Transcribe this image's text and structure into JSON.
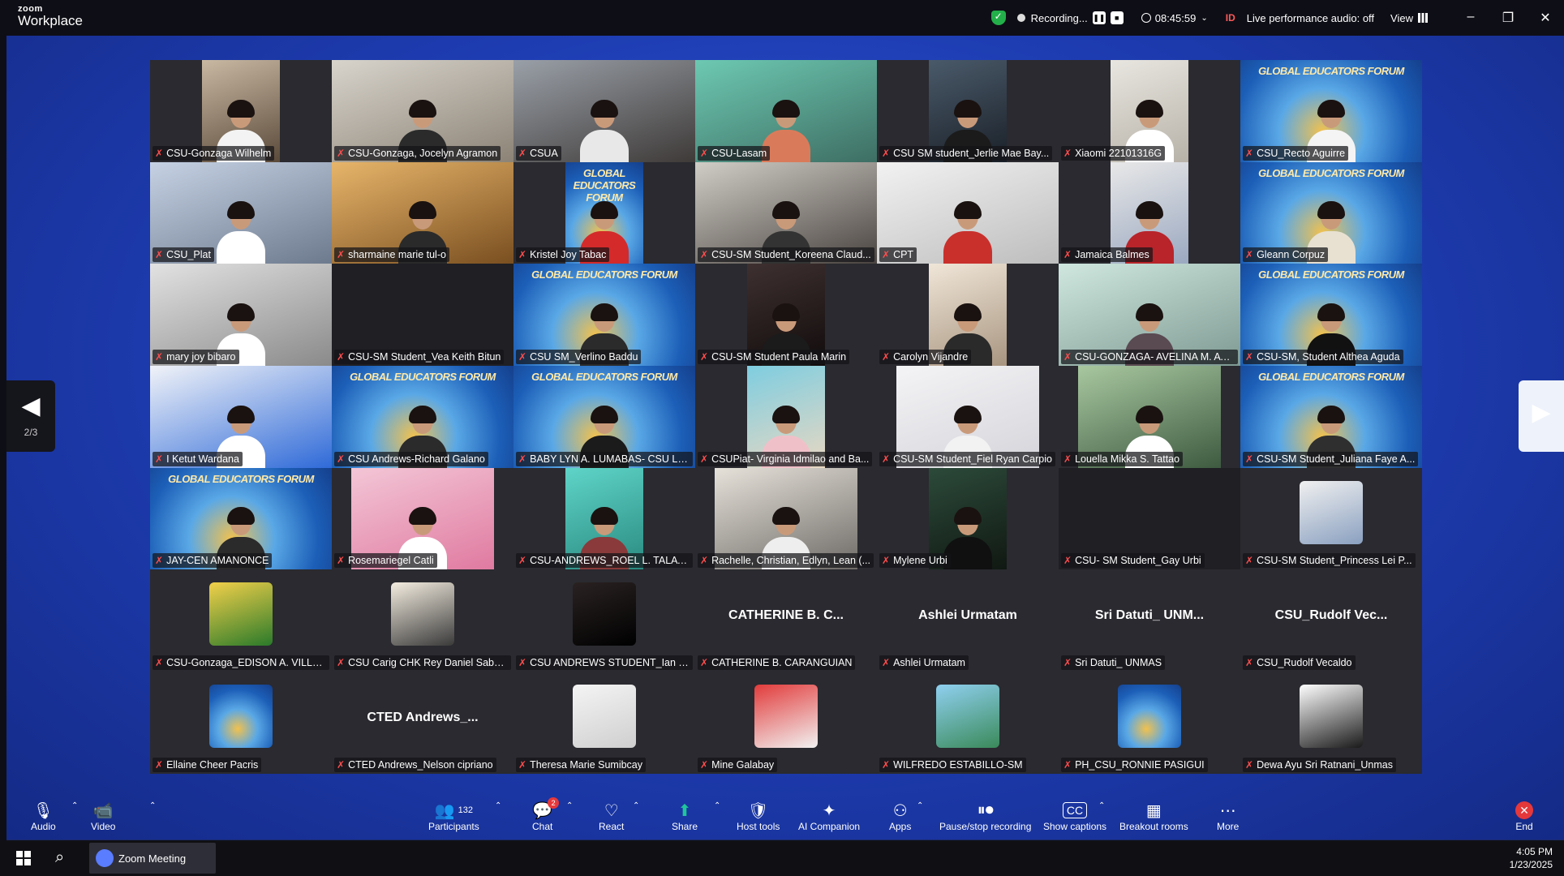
{
  "app": {
    "logo_line1": "zoom",
    "logo_line2": "Workplace",
    "recording_label": "Recording...",
    "timer": "08:45:59",
    "id_tag": "ID",
    "audio_status": "Live performance audio: off",
    "view_label": "View"
  },
  "gallery": {
    "page_indicator": "2/3",
    "forum_text": "GLOBAL EDUCATORS FORUM",
    "tiles": [
      {
        "name": "CSU-Gonzaga Wilhelm",
        "style": "center",
        "c1": "#c9b9a3",
        "c2": "#5b4a3a",
        "shirt": "#f3f3f3"
      },
      {
        "name": "CSU-Gonzaga, Jocelyn Agramon",
        "style": "full",
        "c1": "#d8d4cc",
        "c2": "#8c8376",
        "shirt": "#2b2b2b"
      },
      {
        "name": "CSUA",
        "style": "full",
        "c1": "#9aa0a8",
        "c2": "#3e3a38",
        "shirt": "#e8e8e8"
      },
      {
        "name": "CSU-Lasam",
        "style": "full",
        "c1": "#6dc9b2",
        "c2": "#3e6e64",
        "shirt": "#d97b5a"
      },
      {
        "name": "CSU SM student_Jerlie Mae Bay...",
        "style": "center",
        "c1": "#4a5a6a",
        "c2": "#1a2028",
        "shirt": "#1b1b1b"
      },
      {
        "name": "Xiaomi 22101316G",
        "style": "center",
        "c1": "#e8e6e0",
        "c2": "#b7b2a8",
        "shirt": "#ffffff"
      },
      {
        "name": "CSU_Recto Aguirre",
        "style": "full",
        "forum": true,
        "shirt": "#f4f4f4"
      },
      {
        "name": "CSU_Plat",
        "style": "full",
        "c1": "#c6d2e4",
        "c2": "#6d7a8e",
        "shirt": "#ffffff"
      },
      {
        "name": "sharmaine marie tul-o",
        "style": "full",
        "c1": "#e7b56a",
        "c2": "#7a4f20",
        "shirt": "#2a2a2a"
      },
      {
        "name": "Kristel Joy Tabac",
        "style": "center",
        "forum": true,
        "shirt": "#d42a2a"
      },
      {
        "name": "CSU-SM Student_Koreena Claud...",
        "style": "full",
        "c1": "#d0cdc6",
        "c2": "#4a4440",
        "shirt": "#333333"
      },
      {
        "name": "CPT",
        "style": "full",
        "c1": "#f2f2f2",
        "c2": "#bdbdbd",
        "shirt": "#c9302c"
      },
      {
        "name": "Jamaica Balmes",
        "style": "center",
        "c1": "#e8e8e8",
        "c2": "#9aa8c0",
        "shirt": "#b8242a"
      },
      {
        "name": "Gleann Corpuz",
        "style": "full",
        "forum": true,
        "shirt": "#e8e1d2"
      },
      {
        "name": "mary joy bibaro",
        "style": "full",
        "c1": "#e2e2e2",
        "c2": "#8a8a8a",
        "shirt": "#ffffff"
      },
      {
        "name": "CSU-SM Student_Vea Keith Bitun",
        "style": "empty"
      },
      {
        "name": "CSU SM_Verlino Baddu",
        "style": "full",
        "forum": true,
        "shirt": "#2b2b2b"
      },
      {
        "name": "CSU-SM Student Paula Marin",
        "style": "center",
        "c1": "#3e3030",
        "c2": "#120c0c",
        "shirt": "#1b1b1b"
      },
      {
        "name": "Carolyn Vijandre",
        "style": "center",
        "c1": "#f0e6d8",
        "c2": "#a89580",
        "shirt": "#2a2a2a"
      },
      {
        "name": "CSU-GONZAGA- AVELINA M. AYUYA...",
        "style": "full",
        "c1": "#cfe7df",
        "c2": "#7e9a92",
        "shirt": "#5a4a52"
      },
      {
        "name": "CSU-SM, Student Althea Aguda",
        "style": "full",
        "forum": true,
        "shirt": "#111111"
      },
      {
        "name": "I Ketut Wardana",
        "style": "full",
        "c1": "#f1f3f8",
        "c2": "#2f6ad8",
        "shirt": "#ffffff"
      },
      {
        "name": "CSU Andrews-Richard Galano",
        "style": "full",
        "forum": true,
        "shirt": "#2b2b2b"
      },
      {
        "name": "BABY LYN A. LUMABAS- CSU LAL...",
        "style": "full",
        "forum": true,
        "shirt": "#1b1b1b"
      },
      {
        "name": "CSUPiat- Virginia Idmilao and Ba...",
        "style": "center",
        "c1": "#7ecde0",
        "c2": "#e9d8c2",
        "shirt": "#f0c0c8"
      },
      {
        "name": "CSU-SM Student_Fiel Ryan Carpio",
        "style": "wide",
        "c1": "#f4f4f6",
        "c2": "#d4d4da",
        "shirt": "#f2f2f2"
      },
      {
        "name": "Louella Mikka S. Tattao",
        "style": "wide",
        "c1": "#a8c8a0",
        "c2": "#3e5a40",
        "shirt": "#ffffff"
      },
      {
        "name": "CSU-SM Student_Juliana Faye A...",
        "style": "full",
        "forum": true,
        "shirt": "#2f2f2f"
      },
      {
        "name": "JAY-CEN AMANONCE",
        "style": "full",
        "forum": true,
        "shirt": "#2b2b2b"
      },
      {
        "name": "Rosemariegel Catli",
        "style": "wide",
        "c1": "#f3c6d6",
        "c2": "#e07aa0",
        "shirt": "#ffffff"
      },
      {
        "name": "CSU-ANDREWS_ROEL L. TALATT...",
        "style": "center",
        "c1": "#5fd4c8",
        "c2": "#2a8a80",
        "shirt": "#8a3a3a"
      },
      {
        "name": "Rachelle, Christian, Edlyn, Lean (...",
        "style": "wide",
        "c1": "#e6e2da",
        "c2": "#6e6a66",
        "shirt": "#eeeeee"
      },
      {
        "name": "Mylene Urbi",
        "style": "center",
        "c1": "#2c4a3a",
        "c2": "#101812",
        "shirt": "#101010"
      },
      {
        "name": "CSU- SM Student_Gay Urbi",
        "style": "empty"
      },
      {
        "name": "CSU-SM Student_Princess Lei P...",
        "avatar": true,
        "c1": "#f0f0f0",
        "c2": "#8aa0c0"
      },
      {
        "name": "CSU-Gonzaga_EDISON A. VILLENA",
        "avatar": true,
        "c1": "#f2d04a",
        "c2": "#2a7a2a"
      },
      {
        "name": "CSU Carig CHK Rey Daniel Sabo...",
        "avatar": true,
        "c1": "#f4ede0",
        "c2": "#3a3a3a"
      },
      {
        "name": "CSU ANDREWS STUDENT_Ian Tu...",
        "avatar": true,
        "c1": "#2a2222",
        "c2": "#000000"
      },
      {
        "name": "CATHERINE B. CARANGUIAN",
        "display": "CATHERINE B. C..."
      },
      {
        "name": "Ashlei Urmatam",
        "display": "Ashlei Urmatam"
      },
      {
        "name": "Sri Datuti_ UNMAS",
        "display": "Sri Datuti_ UNM..."
      },
      {
        "name": "CSU_Rudolf Vecaldo",
        "display": "CSU_Rudolf Vec..."
      },
      {
        "name": "Ellaine Cheer Pacris",
        "avatar": true,
        "forum": true
      },
      {
        "name": "CTED Andrews_Nelson cipriano",
        "display": "CTED Andrews_..."
      },
      {
        "name": "Theresa Marie Sumibcay",
        "avatar": true,
        "c1": "#f4f4f4",
        "c2": "#cfcfcf"
      },
      {
        "name": "Mine Galabay",
        "avatar": true,
        "c1": "#e23b3b",
        "c2": "#f2f2f2"
      },
      {
        "name": "WILFREDO ESTABILLO-SM",
        "avatar": true,
        "c1": "#8fd0f0",
        "c2": "#3a8a5a"
      },
      {
        "name": "PH_CSU_RONNIE PASIGUI",
        "avatar": true,
        "forum": true
      },
      {
        "name": "Dewa Ayu Sri Ratnani_Unmas",
        "avatar": true,
        "c1": "#ffffff",
        "c2": "#1a1a1a"
      }
    ]
  },
  "toolbar": {
    "audio": "Audio",
    "video": "Video",
    "participants": "Participants",
    "participants_count": "132",
    "chat": "Chat",
    "chat_badge": "2",
    "react": "React",
    "share": "Share",
    "host_tools": "Host tools",
    "ai_companion": "AI Companion",
    "apps": "Apps",
    "pause_recording": "Pause/stop recording",
    "show_captions": "Show captions",
    "breakout_rooms": "Breakout rooms",
    "more": "More",
    "end": "End"
  },
  "taskbar": {
    "app_name": "Zoom Meeting",
    "time": "4:05 PM",
    "date": "1/23/2025"
  }
}
